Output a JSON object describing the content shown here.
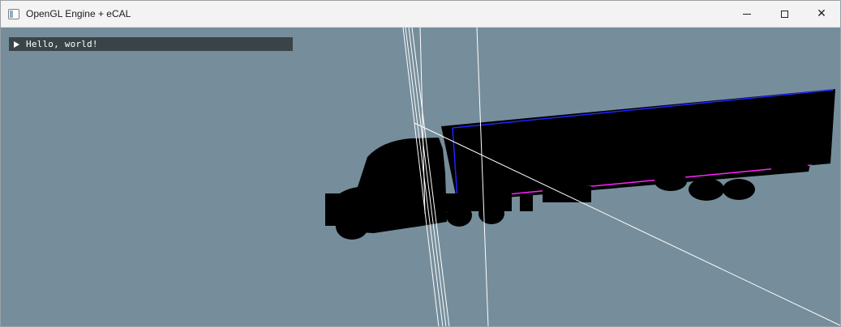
{
  "window": {
    "title": "OpenGL Engine + eCAL",
    "icon": "app-window-icon",
    "controls": {
      "minimize": "minimize-icon",
      "maximize": "maximize-icon",
      "close_glyph": "✕"
    }
  },
  "viewport": {
    "background": "#768e9b",
    "scene": "black truck silhouette with trailer and debug lines",
    "colors": {
      "truck": "#000000",
      "trailer_outline_top": "#2222ff",
      "trailer_outline_bottom": "#ff22ff",
      "debug_lines": "#ffffff"
    }
  },
  "imgui": {
    "header_label": "Hello, world!",
    "header_collapsed": true,
    "header_background": "#3a4448"
  }
}
